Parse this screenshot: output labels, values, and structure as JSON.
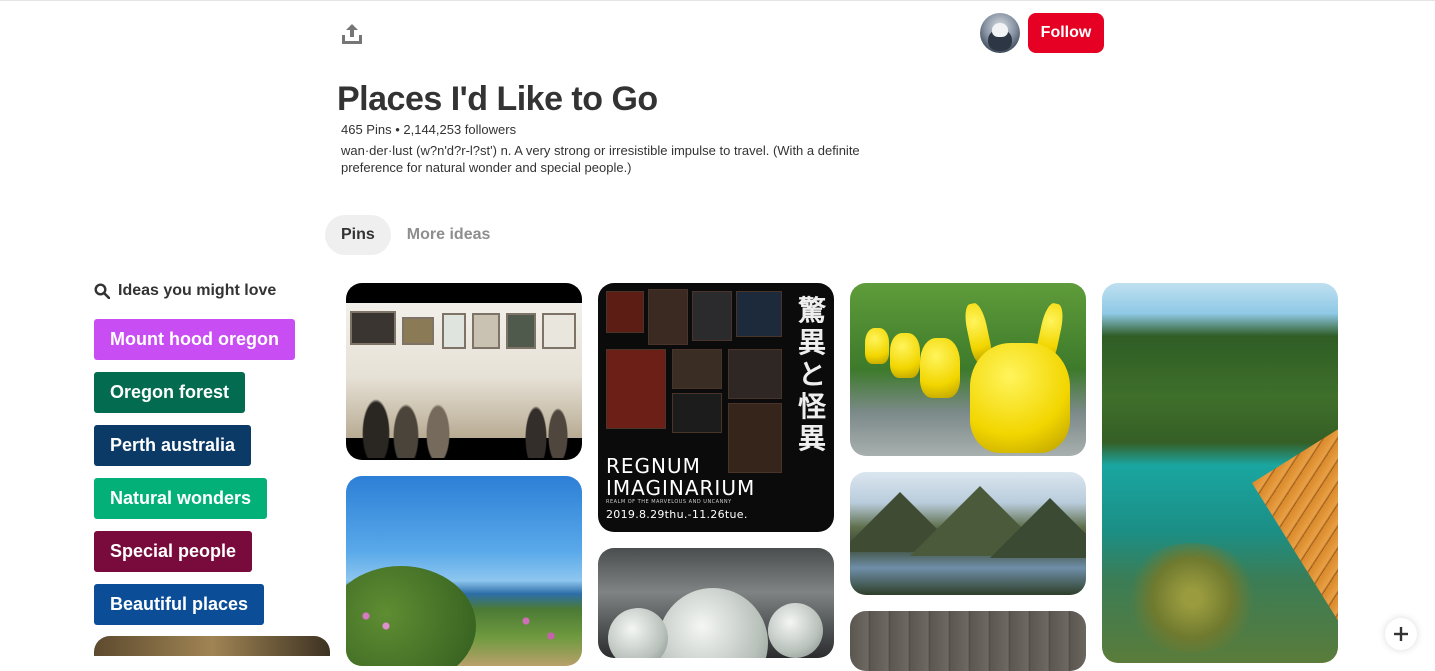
{
  "header": {
    "share_icon": "share-upload-icon",
    "follow_label": "Follow",
    "follow_color": "#e60023"
  },
  "board": {
    "title": "Places I'd Like to Go",
    "stats": "465 Pins • 2,144,253 followers",
    "description": "wan·der·lust (w?n'd?r-l?st') n. A very strong or irresistible impulse to travel. (With a definite preference for natural wonder and special people.)"
  },
  "tabs": [
    {
      "label": "Pins",
      "active": true
    },
    {
      "label": "More ideas",
      "active": false
    }
  ],
  "ideas": {
    "heading": "Ideas you might love",
    "items": [
      {
        "label": "Mount hood oregon",
        "color": "#c84df2"
      },
      {
        "label": "Oregon forest",
        "color": "#036b50"
      },
      {
        "label": "Perth australia",
        "color": "#0c3a66"
      },
      {
        "label": "Natural wonders",
        "color": "#03b178"
      },
      {
        "label": "Special people",
        "color": "#780b3c"
      },
      {
        "label": "Beautiful places",
        "color": "#0b4d97"
      }
    ]
  },
  "pins": {
    "poster": {
      "jp_text": "驚異と怪異",
      "title_line1": "REGNUM",
      "title_line2": "IMAGINARIUM",
      "subtitle": "REALM OF THE MARVELOUS AND UNCANNY",
      "dates": "2019.8.29thu.-11.26tue."
    }
  }
}
